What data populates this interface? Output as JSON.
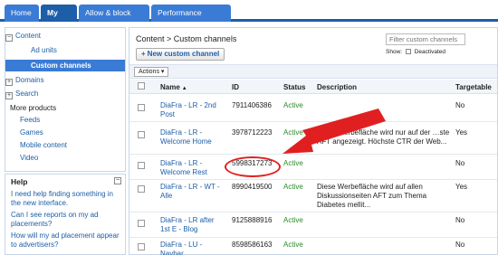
{
  "tabs": [
    "Home",
    "My ads",
    "Allow & block ads",
    "Performance reports"
  ],
  "sidebar": {
    "content_header": "Content",
    "items": [
      "Ad units",
      "Custom channels"
    ],
    "domains": "Domains",
    "search": "Search",
    "more_products": "More products",
    "products": [
      "Feeds",
      "Games",
      "Mobile content",
      "Video"
    ]
  },
  "help": {
    "title": "Help",
    "collapse": "−",
    "links": [
      "I need help finding something in the new interface.",
      "Can I see reports on my ad placements?",
      "How will my ad placement appear to advertisers?"
    ]
  },
  "main": {
    "breadcrumb": "Content > Custom channels",
    "filter_placeholder": "Filter custom channels",
    "show_label": "Show:",
    "deactivated_label": "Deactivated",
    "new_button": "New custom channel",
    "new_button_icon": "+",
    "actions_label": "Actions ▾",
    "columns": [
      "Name",
      "ID",
      "Status",
      "Description",
      "Targetable"
    ],
    "sort_icon": "▲",
    "rows": [
      {
        "name": "DiaFra - LR - 2nd Post",
        "id": "7911406386",
        "status": "Active",
        "description": "",
        "targetable": "No"
      },
      {
        "name": "DiaFra - LR - Welcome Home",
        "id": "3978712223",
        "status": "Active",
        "description": "Diese Werbefläche wird nur auf der …ste AFT angezeigt. Höchste CTR der Web...",
        "targetable": "Yes"
      },
      {
        "name": "DiaFra - LR - Welcome Rest",
        "id": "5998317273",
        "status": "Active",
        "description": "",
        "targetable": "No"
      },
      {
        "name": "DiaFra - LR - WT - Alle",
        "id": "8990419500",
        "status": "Active",
        "description": "Diese Werbefläche wird auf allen Diskussionseiten AFT zum Thema Diabetes mellit...",
        "targetable": "Yes"
      },
      {
        "name": "DiaFra - LR after 1st E - Blog",
        "id": "9125888916",
        "status": "Active",
        "description": "",
        "targetable": "No"
      },
      {
        "name": "DiaFra - LU - Navbar",
        "id": "8598586163",
        "status": "Active",
        "description": "",
        "targetable": "No"
      }
    ]
  },
  "colors": {
    "tab": "#3a7bd5",
    "tab_active": "#1d5ea8",
    "link": "#1d5ea8",
    "active_status": "#2a8a2a",
    "annotation": "#e02020"
  }
}
